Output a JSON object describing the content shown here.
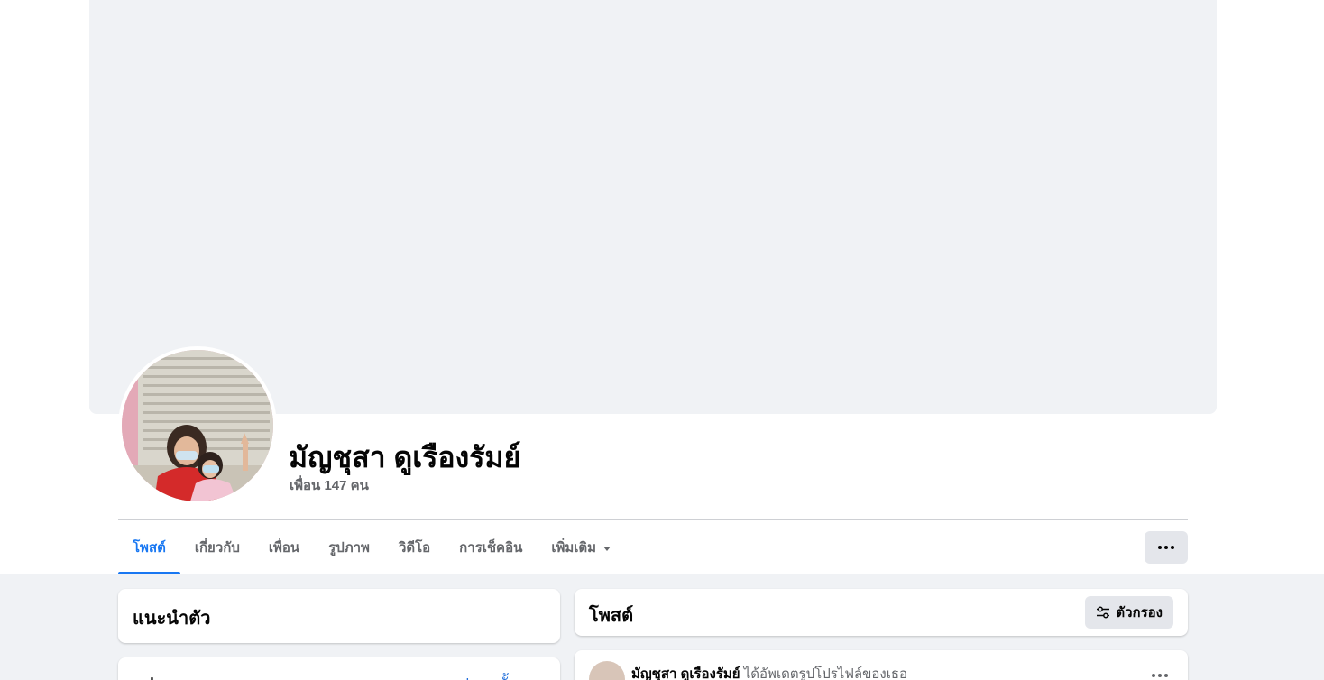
{
  "profile": {
    "name": "มัญชุสา ดูเรืองรัมย์",
    "friends": "เพื่อน 147 คน"
  },
  "tabs": [
    {
      "label": "โพสต์",
      "active": true
    },
    {
      "label": "เกี่ยวกับ",
      "active": false
    },
    {
      "label": "เพื่อน",
      "active": false
    },
    {
      "label": "รูปภาพ",
      "active": false
    },
    {
      "label": "วิดีโอ",
      "active": false
    },
    {
      "label": "การเช็คอิน",
      "active": false
    },
    {
      "label": "เพิ่มเติม",
      "active": false
    }
  ],
  "intro": {
    "title": "แนะนำตัว"
  },
  "photos": {
    "title": "รูปภาพ",
    "see_all": "ดูรูปภาพทั้งหมด"
  },
  "posts": {
    "title": "โพสต์",
    "filter_label": "ตัวกรอง"
  },
  "post": {
    "author": "มัญชุสา ดูเรืองรัมย์",
    "action": "ได้อัพเดตรูปโปรไฟล์ของเธอ"
  },
  "colors": {
    "accent": "#1877f2",
    "link": "#216fdb",
    "secondary_text": "#65676b",
    "button_bg": "#e4e6eb",
    "page_bg": "#f0f2f5"
  }
}
